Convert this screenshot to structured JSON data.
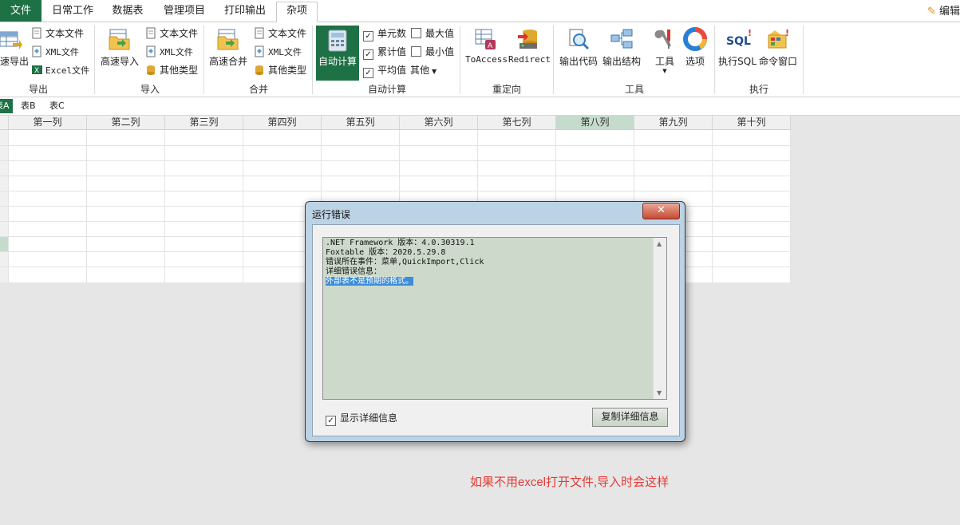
{
  "tabs": {
    "file": "文件",
    "items": [
      "日常工作",
      "数据表",
      "管理项目",
      "打印输出",
      "杂项"
    ],
    "active": "杂项",
    "edit_link": "编辑"
  },
  "ribbon": {
    "export": {
      "big": "速导出",
      "items": [
        "文本文件",
        "XML文件",
        "Excel文件"
      ],
      "label": "导出"
    },
    "import": {
      "big": "高速导入",
      "items": [
        "文本文件",
        "XML文件",
        "其他类型"
      ],
      "label": "导入"
    },
    "merge": {
      "big": "高速合并",
      "items": [
        "文本文件",
        "XML文件",
        "其他类型"
      ],
      "label": "合并"
    },
    "autocalc": {
      "big": "自动计算",
      "checks": {
        "count": {
          "label": "单元数",
          "checked": true
        },
        "sum": {
          "label": "累计值",
          "checked": true
        },
        "avg": {
          "label": "平均值",
          "checked": true
        },
        "max": {
          "label": "最大值",
          "checked": false
        },
        "min": {
          "label": "最小值",
          "checked": false
        }
      },
      "other": "其他",
      "label": "自动计算"
    },
    "redirect": {
      "toaccess": "ToAccess",
      "redirect": "Redirect",
      "label": "重定向"
    },
    "tools": {
      "output_code": "输出代码",
      "output_structure": "输出结构",
      "tools": "工具",
      "options": "选项",
      "label": "工具"
    },
    "execute": {
      "exec_sql": "执行SQL",
      "cmd_window": "命令窗口",
      "label": "执行"
    }
  },
  "sheet_tabs": [
    "表A",
    "表B",
    "表C"
  ],
  "sheet_tabs_visible": [
    "表A",
    "表B",
    "表C"
  ],
  "sheet_tab_active": "表A",
  "columns": [
    "第一列",
    "第二列",
    "第三列",
    "第四列",
    "第五列",
    "第六列",
    "第七列",
    "第八列",
    "第九列",
    "第十列"
  ],
  "selected_column": "第八列",
  "dialog": {
    "title": "运行错误",
    "close_symbol": "✕",
    "lines": [
      ".NET Framework 版本：4.0.30319.1",
      "Foxtable 版本：2020.5.29.8",
      "错误所在事件：菜单,QuickImport,Click",
      "详细错误信息：",
      "外部表不是预期的格式。"
    ],
    "show_detail_label": "显示详细信息",
    "show_detail_checked": true,
    "copy_button": "复制详细信息"
  },
  "note": "如果不用excel打开文件,导入时会这样"
}
